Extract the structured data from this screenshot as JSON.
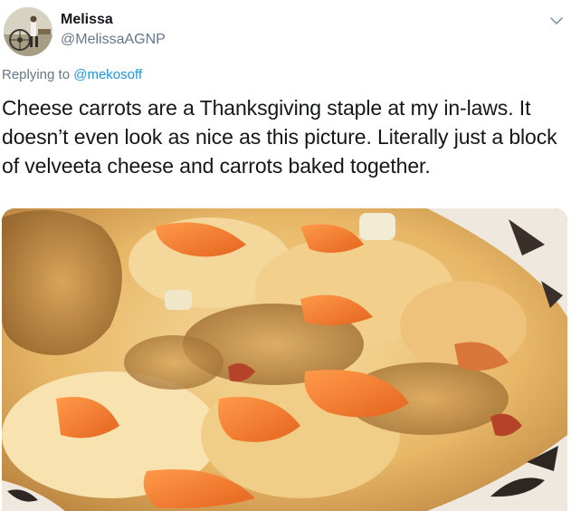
{
  "tweet": {
    "author": {
      "display_name": "Melissa",
      "handle": "@MelissaAGNP"
    },
    "reply": {
      "prefix": "Replying to ",
      "mention": "@mekosoff"
    },
    "text": "Cheese carrots are a Thanksgiving staple at my in-laws. It doesn’t even look as nice as this picture. Literally just a block of velveeta cheese and carrots baked together.",
    "icons": {
      "menu": "chevron-down-icon"
    },
    "colors": {
      "text": "#14171a",
      "secondary": "#657786",
      "link": "#1b95e0"
    }
  }
}
